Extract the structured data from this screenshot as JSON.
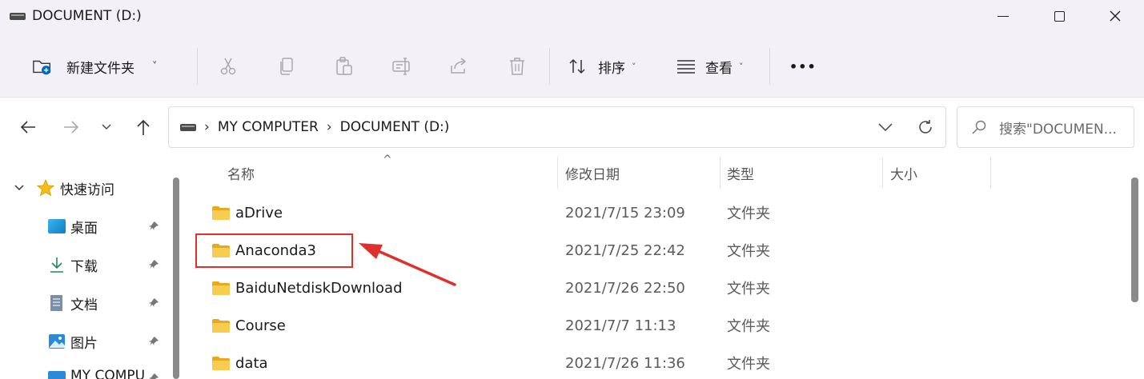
{
  "window": {
    "title": "DOCUMENT (D:)",
    "controls": {
      "minimize": "–",
      "maximize": "☐",
      "close": "✕"
    }
  },
  "toolbar": {
    "new_folder_label": "新建文件夹",
    "sort_label": "排序",
    "view_label": "查看",
    "more_label": "•••"
  },
  "nav": {
    "back": "←",
    "forward": "→",
    "recent": "˅",
    "up": "↑"
  },
  "address": {
    "crumbs": [
      "MY COMPUTER",
      "DOCUMENT (D:)"
    ],
    "separator": "›"
  },
  "search": {
    "placeholder": "搜索\"DOCUMEN..."
  },
  "sidebar": {
    "quick_access": "快速访问",
    "items": [
      {
        "label": "桌面",
        "icon": "desktop-icon",
        "pinned": true
      },
      {
        "label": "下载",
        "icon": "download-icon",
        "pinned": true
      },
      {
        "label": "文档",
        "icon": "document-icon",
        "pinned": true
      },
      {
        "label": "图片",
        "icon": "picture-icon",
        "pinned": true
      },
      {
        "label": "MY COMPU",
        "icon": "computer-icon",
        "pinned": true
      }
    ]
  },
  "table": {
    "columns": {
      "name": "名称",
      "modified": "修改日期",
      "type": "类型",
      "size": "大小"
    },
    "sort_indicator": "^",
    "rows": [
      {
        "name": "aDrive",
        "modified": "2021/7/15 23:09",
        "type": "文件夹"
      },
      {
        "name": "Anaconda3",
        "modified": "2021/7/25 22:42",
        "type": "文件夹"
      },
      {
        "name": "BaiduNetdiskDownload",
        "modified": "2021/7/26 22:50",
        "type": "文件夹"
      },
      {
        "name": "Course",
        "modified": "2021/7/7 11:13",
        "type": "文件夹"
      },
      {
        "name": "data",
        "modified": "2021/7/26 11:36",
        "type": "文件夹"
      }
    ]
  },
  "colors": {
    "chrome_bg": "#f3f0f7",
    "folder_yellow": "#f5c242",
    "annotation_red": "#e0302c",
    "accent_blue": "#0067c0"
  }
}
